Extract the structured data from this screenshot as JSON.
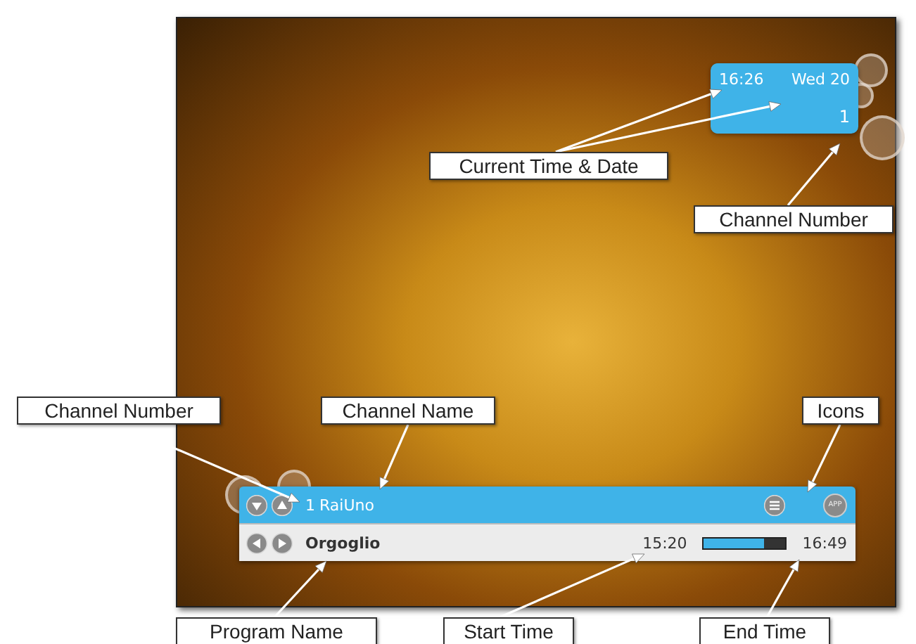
{
  "tv_screen": {
    "clock_panel": {
      "time": "16:26",
      "date": "Wed 20",
      "channel_number": "1"
    },
    "info_bar": {
      "channel_number": "1",
      "channel_name": "RaiUno",
      "app_button": "APP",
      "program_name": "Orgoglio",
      "start_time": "15:20",
      "progress": {
        "level": 0.74
      },
      "end_time": "16:49"
    }
  },
  "callouts": [
    {
      "label": "Current Time & Date"
    },
    {
      "label": "Channel Number"
    },
    {
      "label": "Channel Number"
    },
    {
      "label": "Channel Name"
    },
    {
      "label": "Icons"
    },
    {
      "label": "Program Name"
    },
    {
      "label": "Start Time"
    },
    {
      "label": "End Time"
    }
  ]
}
